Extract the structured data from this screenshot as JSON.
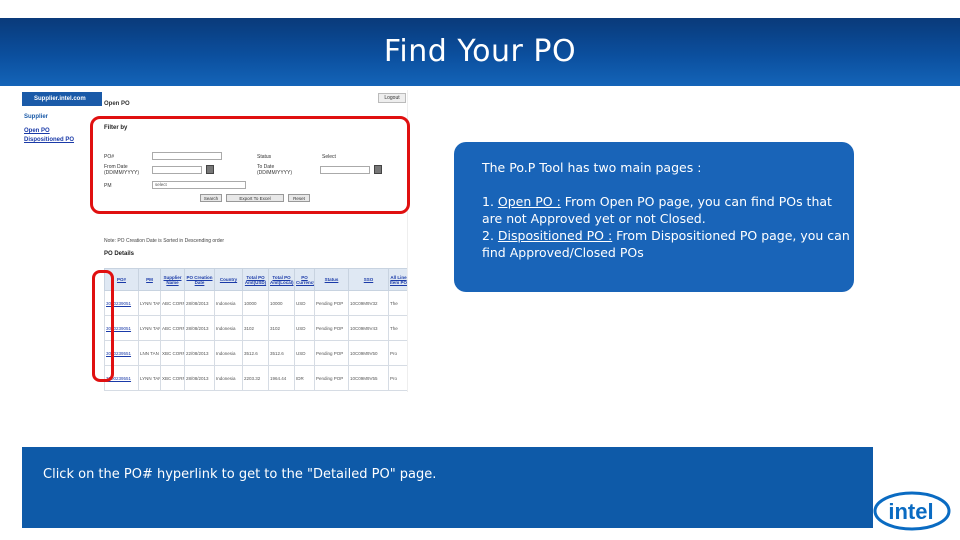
{
  "title": "Find Your PO",
  "screenshot": {
    "brand": "Supplier.intel.com",
    "page_label": "Open PO",
    "logout": "Logout",
    "sidebar": {
      "heading": "Supplier",
      "links": [
        "Open PO",
        "Dispositioned PO"
      ]
    },
    "filter": {
      "title": "Filter by",
      "po_label": "PO#",
      "from_label": "From Date\n(DD/MM/YYYY)",
      "to_label": "To Date\n(DD/MM/YYYY)",
      "pm_label": "PM",
      "pm_value": "select",
      "status_label": "Status",
      "status_value": "Select",
      "buttons": [
        "Search",
        "Export To Excel",
        "Reset"
      ]
    },
    "note": "Note: PO Creation Date is Sorted in Descending order",
    "details_title": "PO Details",
    "table": {
      "headers": [
        "PO#",
        "PM",
        "Supplier Name",
        "PO Creation Date",
        "Country",
        "Total PO Amt(USD)",
        "Total PO Amt(Local)",
        "PO Currency",
        "Status",
        "SSO",
        "All Line Item PO"
      ],
      "rows": [
        [
          "3000239051",
          "LYNN TAN",
          "ABC CORP",
          "28/08/2013",
          "Indonesia",
          "10000",
          "10000",
          "USD",
          "Pending POP",
          "10C09M9V32",
          "The"
        ],
        [
          "3000239051",
          "LYNN TAN",
          "ABC CORP",
          "28/08/2013",
          "Indonesia",
          "3102",
          "3102",
          "USD",
          "Pending POP",
          "10C09M9V43",
          "The"
        ],
        [
          "3000239551",
          "LNN TAN",
          "XBC CORP",
          "22/08/2013",
          "Indonesia",
          "3512.6",
          "3512.6",
          "USD",
          "Pending POP",
          "10C09M9V50",
          "Pro"
        ],
        [
          "3000239551",
          "LYNN TAN",
          "XBC CORP",
          "28/08/2013",
          "Indonesia",
          "2203.32",
          "1964.44",
          "IDR",
          "Pending POP",
          "10C09M9V55",
          "Pro"
        ]
      ]
    }
  },
  "info_box": {
    "intro": "The Po.P Tool has two main pages :",
    "item1_prefix": "1. ",
    "item1_link": "Open PO :",
    "item1_text": " From Open PO page, you can find POs that are not Approved yet or not Closed.",
    "item2_prefix": "2. ",
    "item2_link": "Dispositioned PO :",
    "item2_text": " From Dispositioned PO page, you can find Approved/Closed POs"
  },
  "instruction": "Click on the PO# hyperlink to get to the \"Detailed PO\" page.",
  "logo_text": "intel",
  "colors": {
    "title_band": "#0b4f9e",
    "info_box": "#1964b8",
    "bottom_band": "#0e5aa8",
    "highlight": "#e01010",
    "logo": "#0a6bc2"
  }
}
